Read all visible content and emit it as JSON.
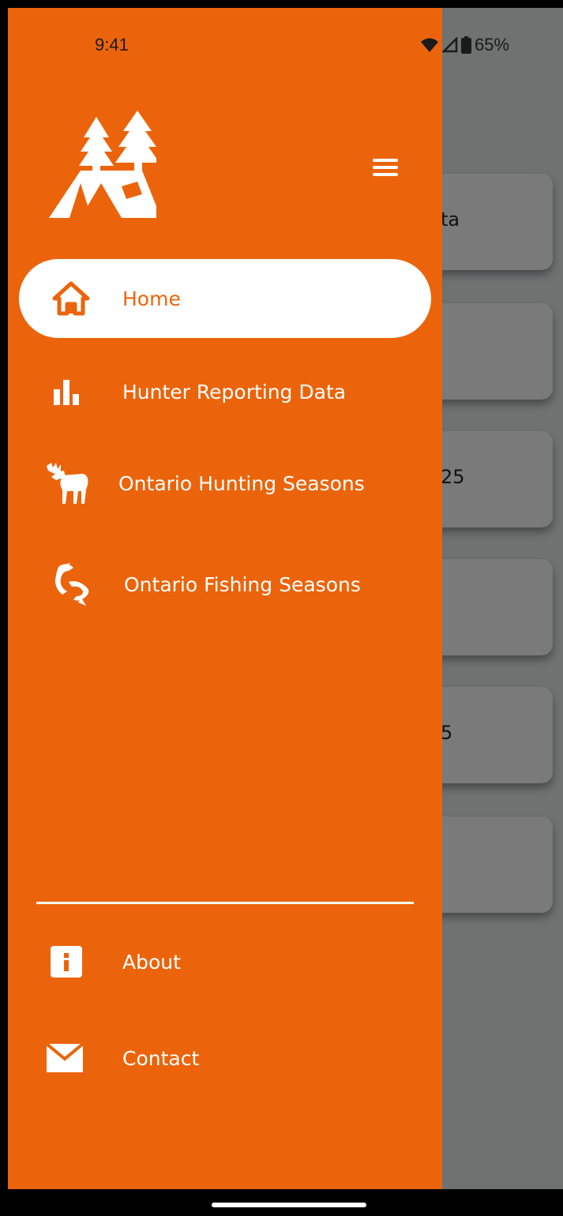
{
  "status_bar": {
    "time": "9:41",
    "battery": "65%"
  },
  "background_cards": [
    "ta",
    "",
    "25",
    "",
    "5",
    ""
  ],
  "nav": {
    "items": [
      {
        "label": "Home",
        "icon": "home-icon",
        "active": true
      },
      {
        "label": "Hunter Reporting Data",
        "icon": "bar-chart-icon",
        "active": false
      },
      {
        "label": "Ontario Hunting Seasons",
        "icon": "moose-icon",
        "active": false
      },
      {
        "label": "Ontario Fishing Seasons",
        "icon": "fish-icon",
        "active": false
      }
    ],
    "footer": [
      {
        "label": "About",
        "icon": "info-icon"
      },
      {
        "label": "Contact",
        "icon": "mail-icon"
      }
    ]
  },
  "colors": {
    "accent": "#eb640b",
    "scrim": "#6e7271",
    "text": "#ffffff"
  }
}
